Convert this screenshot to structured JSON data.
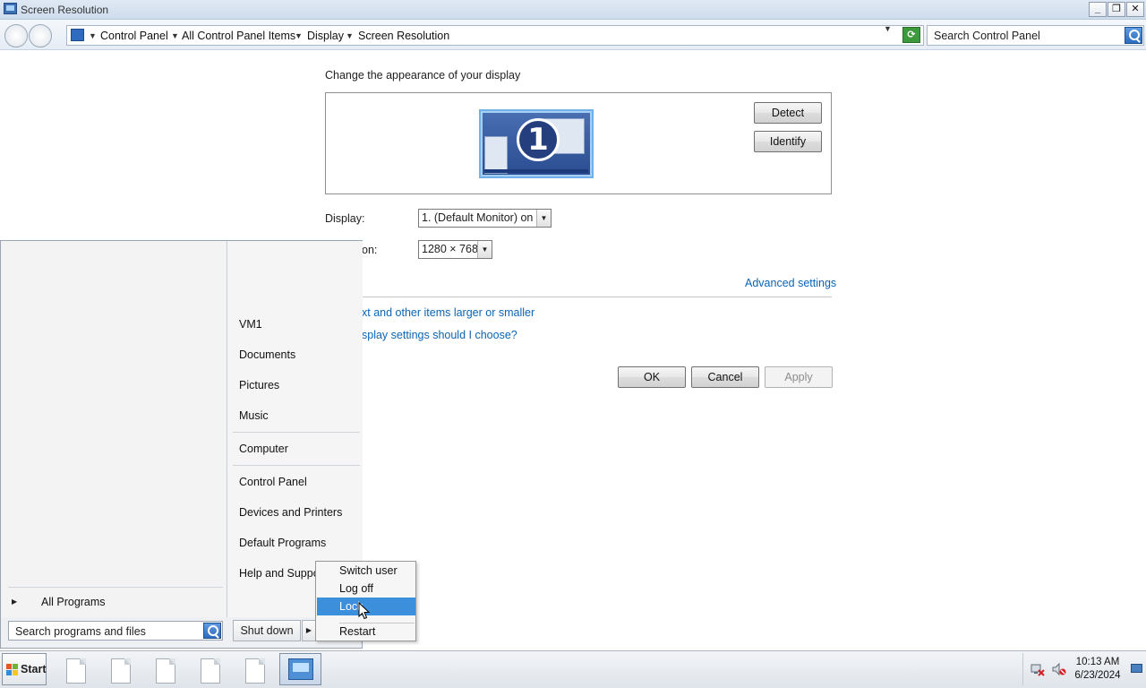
{
  "window": {
    "title": "Screen Resolution",
    "controls": {
      "minimize": "_",
      "restore": "❐",
      "close": "✕"
    }
  },
  "address": {
    "breadcrumbs": [
      "Control Panel",
      "All Control Panel Items",
      "Display",
      "Screen Resolution"
    ],
    "search_placeholder": "Search Control Panel"
  },
  "main": {
    "heading": "Change the appearance of your display",
    "monitor_number": "1",
    "detect_label": "Detect",
    "identify_label": "Identify",
    "display_label": "Display:",
    "display_value": "1. (Default Monitor) on",
    "resolution_label_partial": "on:",
    "resolution_value": "1280 × 768",
    "advanced_link": "Advanced settings",
    "link_text_size": "xt and other items larger or smaller",
    "link_display_settings": "splay settings should I choose?",
    "ok_label": "OK",
    "cancel_label": "Cancel",
    "apply_label": "Apply"
  },
  "start_menu": {
    "right_items": [
      "VM1",
      "Documents",
      "Pictures",
      "Music",
      "Computer",
      "Control Panel",
      "Devices and Printers",
      "Default Programs",
      "Help and Suppo"
    ],
    "all_programs": "All Programs",
    "search_placeholder": "Search programs and files",
    "shutdown_label": "Shut down"
  },
  "shutdown_submenu": {
    "items": [
      "Switch user",
      "Log off",
      "Lock",
      "Restart"
    ],
    "highlighted": "Lock"
  },
  "taskbar": {
    "start_label": "Start",
    "time": "10:13 AM",
    "date": "6/23/2024"
  },
  "colors": {
    "link": "#0c64b4",
    "highlight": "#3b8fdb"
  }
}
